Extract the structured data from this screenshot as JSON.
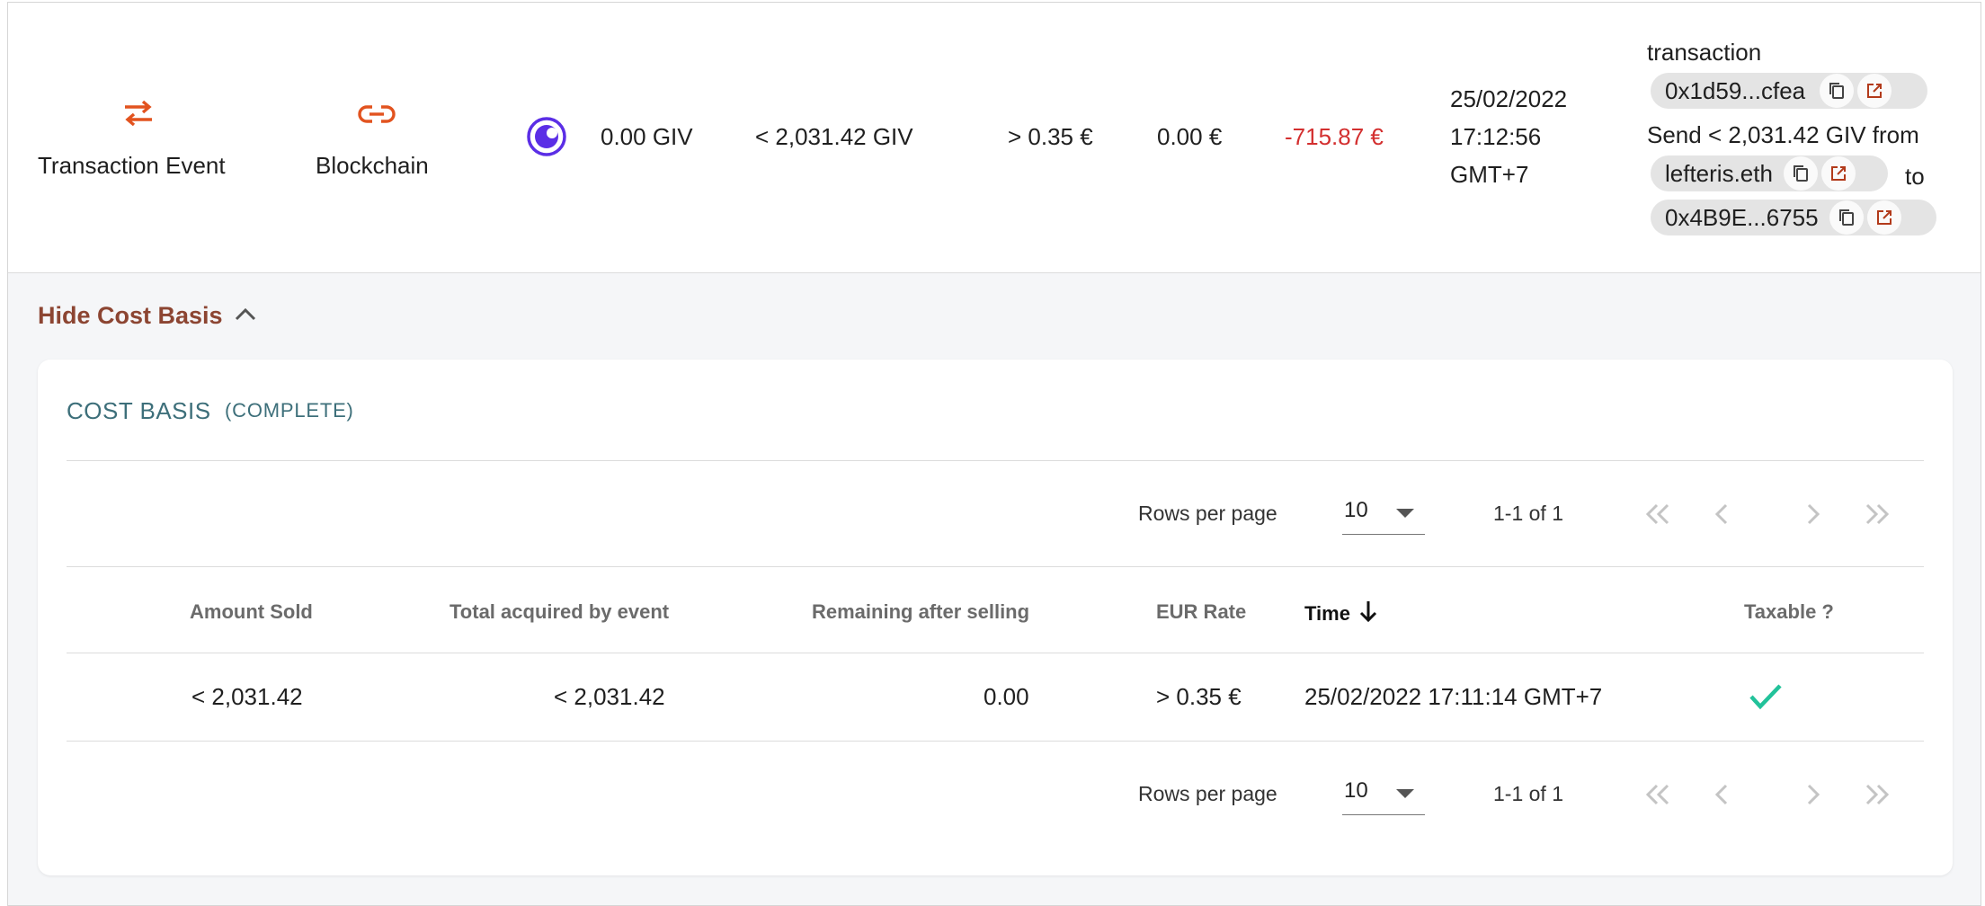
{
  "event": {
    "type_label": "Transaction Event",
    "location_label": "Blockchain",
    "amount": "0.00 GIV",
    "amount_lt": "< 2,031.42 GIV",
    "rate": "> 0.35 €",
    "value": "0.00 €",
    "pnl": "-715.87 €",
    "date": "25/02/2022",
    "time": "17:12:56",
    "tz": "GMT+7",
    "notes": {
      "line1": "transaction",
      "tx_hash": "0x1d59...cfea",
      "line2": "Send < 2,031.42 GIV from",
      "from": "lefteris.eth",
      "to_word": "to",
      "to_addr": "0x4B9E...6755"
    },
    "icons": {
      "event_type": "swap-arrows-icon",
      "location": "link-icon",
      "asset": "giveth-logo-icon"
    },
    "colors": {
      "accent": "#e2531f",
      "negative": "#d32f2f"
    }
  },
  "toggle": {
    "label": "Hide Cost Basis"
  },
  "cost_basis": {
    "title": "COST BASIS",
    "status": "(COMPLETE)",
    "pagination": {
      "rows_per_page_label": "Rows per page",
      "rows_per_page_value": "10",
      "range": "1-1 of 1"
    },
    "columns": [
      "Amount Sold",
      "Total acquired by event",
      "Remaining after selling",
      "EUR Rate",
      "Time",
      "Taxable ?"
    ],
    "rows": [
      {
        "amount_sold": "< 2,031.42",
        "total_acquired": "< 2,031.42",
        "remaining": "0.00",
        "rate": "> 0.35 €",
        "time": "25/02/2022 17:11:14 GMT+7",
        "taxable": true
      }
    ],
    "colors": {
      "title": "#3d6f7a",
      "check": "#22c29a"
    }
  }
}
